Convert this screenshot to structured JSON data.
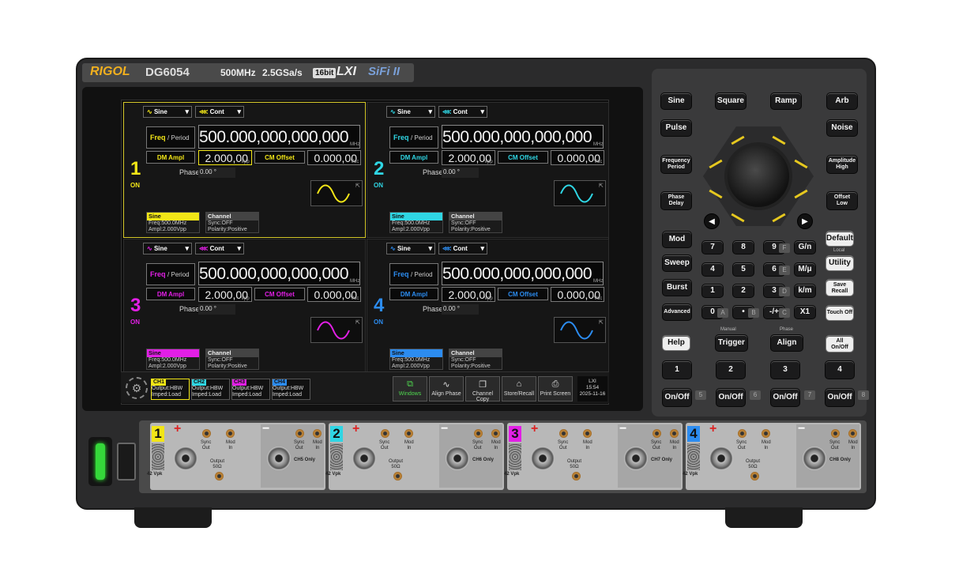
{
  "brand": {
    "logo": "RIGOL",
    "model": "DG6054",
    "bandwidth": "500MHz",
    "sample_rate": "2.5GSa/s",
    "bits": "16bit",
    "lxi": "LXI",
    "sifi": "SiFi II"
  },
  "colors": {
    "ch1": "#f2e617",
    "ch2": "#2fd6e4",
    "ch3": "#e21fe6",
    "ch4": "#2c8cf0"
  },
  "channels": [
    {
      "num": "1",
      "state": "ON",
      "wave": "Sine",
      "mode": "Cont",
      "freq_label": "Freq",
      "freq_sub": "/ Period",
      "freq_value": "500.000,000,000,000",
      "freq_unit": "MHz",
      "ampl_label": "DM Ampl",
      "ampl_value": "2.000,00",
      "ampl_unit": "Vpp",
      "offset_label": "CM Offset",
      "offset_value": "0.000,00",
      "offset_unit": "Vdc",
      "phase_label": "Phase",
      "phase_value": "0.00 °",
      "info_title": "Sine",
      "info_freq": "Freq:500.0MHz",
      "info_ampl": "Ampl:2.000Vpp",
      "chan_title": "Channel",
      "chan_sync": "Sync:OFF",
      "chan_pol": "Polarity:Positive"
    },
    {
      "num": "2",
      "state": "ON",
      "wave": "Sine",
      "mode": "Cont",
      "freq_label": "Freq",
      "freq_sub": "/ Period",
      "freq_value": "500.000,000,000,000",
      "freq_unit": "MHz",
      "ampl_label": "DM Ampl",
      "ampl_value": "2.000,00",
      "ampl_unit": "Vpp",
      "offset_label": "CM Offset",
      "offset_value": "0.000,00",
      "offset_unit": "Vdc",
      "phase_label": "Phase",
      "phase_value": "0.00 °",
      "info_title": "Sine",
      "info_freq": "Freq:500.0MHz",
      "info_ampl": "Ampl:2.000Vpp",
      "chan_title": "Channel",
      "chan_sync": "Sync:OFF",
      "chan_pol": "Polarity:Positive"
    },
    {
      "num": "3",
      "state": "ON",
      "wave": "Sine",
      "mode": "Cont",
      "freq_label": "Freq",
      "freq_sub": "/ Period",
      "freq_value": "500.000,000,000,000",
      "freq_unit": "MHz",
      "ampl_label": "DM Ampl",
      "ampl_value": "2.000,00",
      "ampl_unit": "Vpp",
      "offset_label": "CM Offset",
      "offset_value": "0.000,00",
      "offset_unit": "Vdc",
      "phase_label": "Phase",
      "phase_value": "0.00 °",
      "info_title": "Sine",
      "info_freq": "Freq:500.0MHz",
      "info_ampl": "Ampl:2.000Vpp",
      "chan_title": "Channel",
      "chan_sync": "Sync:OFF",
      "chan_pol": "Polarity:Positive"
    },
    {
      "num": "4",
      "state": "ON",
      "wave": "Sine",
      "mode": "Cont",
      "freq_label": "Freq",
      "freq_sub": "/ Period",
      "freq_value": "500.000,000,000,000",
      "freq_unit": "MHz",
      "ampl_label": "DM Ampl",
      "ampl_value": "2.000,00",
      "ampl_unit": "Vpp",
      "offset_label": "CM Offset",
      "offset_value": "0.000,00",
      "offset_unit": "Vdc",
      "phase_label": "Phase",
      "phase_value": "0.00 °",
      "info_title": "Sine",
      "info_freq": "Freq:500.0MHz",
      "info_ampl": "Ampl:2.000Vpp",
      "chan_title": "Channel",
      "chan_sync": "Sync:OFF",
      "chan_pol": "Polarity:Positive"
    }
  ],
  "tiles": [
    {
      "title": "CH1",
      "line1": "Output:HBW",
      "line2": "Imped:Load"
    },
    {
      "title": "CH2",
      "line1": "Output:HBW",
      "line2": "Imped:Load"
    },
    {
      "title": "CH3",
      "line1": "Output:HBW",
      "line2": "Imped:Load"
    },
    {
      "title": "CH4",
      "line1": "Output:HBW",
      "line2": "Imped:Load"
    }
  ],
  "toolbar": {
    "windows": "Windows",
    "align_phase": "Align Phase",
    "channel_copy": "Channel Copy",
    "store_recall": "Store/Recall",
    "print_screen": "Print Screen"
  },
  "status": {
    "lxi": "LXI",
    "time": "15:54",
    "date": "2025-11-16"
  },
  "keys": {
    "sine": "Sine",
    "square": "Square",
    "ramp": "Ramp",
    "arb": "Arb",
    "pulse": "Pulse",
    "noise": "Noise",
    "freq": "Frequency",
    "period": "Period",
    "ampl": "Amplitude",
    "high": "High",
    "phase": "Phase",
    "delay": "Delay",
    "offset": "Offset",
    "low": "Low",
    "mod": "Mod",
    "sweep": "Sweep",
    "burst": "Burst",
    "advanced": "Advanced",
    "n7": "7",
    "n8": "8",
    "n9": "9",
    "n4": "4",
    "n5": "5",
    "n6": "6",
    "n1": "1",
    "n2": "2",
    "n3": "3",
    "n0": "0",
    "dot": "•",
    "pm": "-/+",
    "gn": "G/n",
    "mmu": "M/μ",
    "km": "k/m",
    "x1": "X1",
    "default": "Default",
    "local": "Local",
    "utility": "Utility",
    "save": "Save",
    "recall": "Recall",
    "touch": "Touch Off",
    "help": "Help",
    "manual": "Manual",
    "trigger": "Trigger",
    "phase_small": "Phase",
    "align": "Align",
    "all": "All",
    "alloff": "On/Off",
    "ch1": "1",
    "ch2": "2",
    "ch3": "3",
    "ch4": "4",
    "onoff": "On/Off",
    "fF": "F",
    "fE": "E",
    "fD": "D",
    "fC": "C",
    "fA": "A",
    "fB": "B",
    "f5": "5",
    "f6": "6",
    "f7": "7",
    "f8": "8"
  },
  "io": {
    "sync": "Sync",
    "out": "Out",
    "mod": "Mod",
    "in": "In",
    "output": "Output",
    "ohm": "50Ω",
    "vpk": "42 Vpk",
    "plus": "+",
    "minus": "−",
    "only": [
      "CH5 Only",
      "CH6 Only",
      "CH7 Only",
      "CH8 Only"
    ],
    "nums": [
      "1",
      "2",
      "3",
      "4"
    ]
  }
}
